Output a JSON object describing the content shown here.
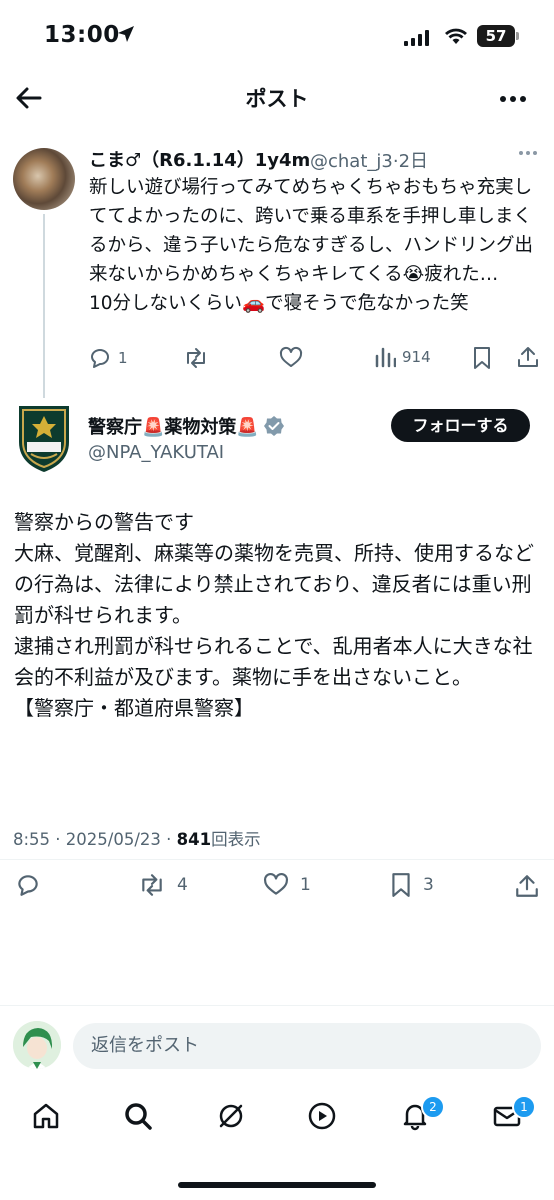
{
  "status_bar": {
    "time": "13:00",
    "battery": "57"
  },
  "header": {
    "title": "ポスト"
  },
  "quoted_post": {
    "name": "こま♂（R6.1.14）1y4m",
    "handle": "@chat_j3",
    "time": "·2日",
    "text": "新しい遊び場行ってみてめちゃくちゃおもちゃ充実しててよかったのに、跨いで乗る車系を手押し車しまくるから、違う子いたら危なすぎるし、ハンドリング出来ないからかめちゃくちゃキレてくる😭疲れた…\n10分しないくらい🚗で寝そうで危なかった笑",
    "replies": "1",
    "views": "914"
  },
  "main_post": {
    "name": "警察庁🚨薬物対策🚨",
    "handle": "@NPA_YAKUTAI",
    "follow_label": "フォローする",
    "text": "警察からの警告です\n大麻、覚醒剤、麻薬等の薬物を売買、所持、使用するなどの行為は、法律により禁止されており、違反者には重い刑罰が科せられます。\n逮捕され刑罰が科せられることで、乱用者本人に大きな社会的不利益が及びます。薬物に手を出さないこと。\n【警察庁・都道府県警察】",
    "timestamp": "8:55 · 2025/05/23 · ",
    "view_count": "841",
    "view_label": "回表示",
    "reposts": "4",
    "likes": "1",
    "bookmarks": "3"
  },
  "reply_bar": {
    "placeholder": "返信をポスト"
  },
  "tab_bar": {
    "notifications_badge": "2",
    "messages_badge": "1"
  },
  "colors": {
    "accent": "#1d9bf0",
    "text": "#0f1419",
    "secondary": "#536471"
  },
  "icons": [
    "back-arrow-icon",
    "more-icon",
    "reply-icon",
    "repost-icon",
    "like-icon",
    "views-icon",
    "bookmark-icon",
    "share-icon",
    "verified-icon",
    "home-icon",
    "search-icon",
    "grok-icon",
    "video-icon",
    "bell-icon",
    "mail-icon"
  ]
}
